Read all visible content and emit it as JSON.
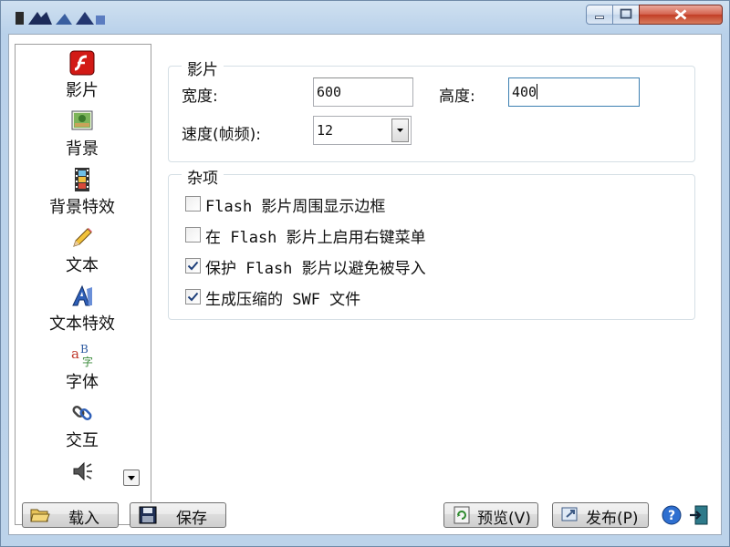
{
  "sidebar": {
    "items": [
      {
        "label": "影片",
        "icon": "flash-movie-icon"
      },
      {
        "label": "背景",
        "icon": "background-picture-icon"
      },
      {
        "label": "背景特效",
        "icon": "film-strip-icon"
      },
      {
        "label": "文本",
        "icon": "pencil-icon"
      },
      {
        "label": "文本特效",
        "icon": "text-effect-icon"
      },
      {
        "label": "字体",
        "icon": "font-icon"
      },
      {
        "label": "交互",
        "icon": "link-icon"
      },
      {
        "label": "",
        "icon": "sound-icon"
      }
    ]
  },
  "movie_group": {
    "title": "影片",
    "width_label": "宽度:",
    "width_value": "600",
    "height_label": "高度:",
    "height_value": "400",
    "speed_label": "速度(帧频):",
    "speed_value": "12"
  },
  "misc_group": {
    "title": "杂项",
    "options": [
      {
        "label": "Flash 影片周围显示边框",
        "checked": false
      },
      {
        "label": "在 Flash 影片上启用右键菜单",
        "checked": false
      },
      {
        "label": "保护 Flash 影片以避免被导入",
        "checked": true
      },
      {
        "label": "生成压缩的 SWF 文件",
        "checked": true
      }
    ]
  },
  "buttons": {
    "load": "载入",
    "save": "保存",
    "preview": "预览(V)",
    "publish": "发布(P)"
  },
  "colors": {
    "title_gradient_top": "#cfe0f0",
    "close_button": "#c23d25",
    "check_mark": "#1e3f7a",
    "focus_border": "#3c7fb1"
  }
}
